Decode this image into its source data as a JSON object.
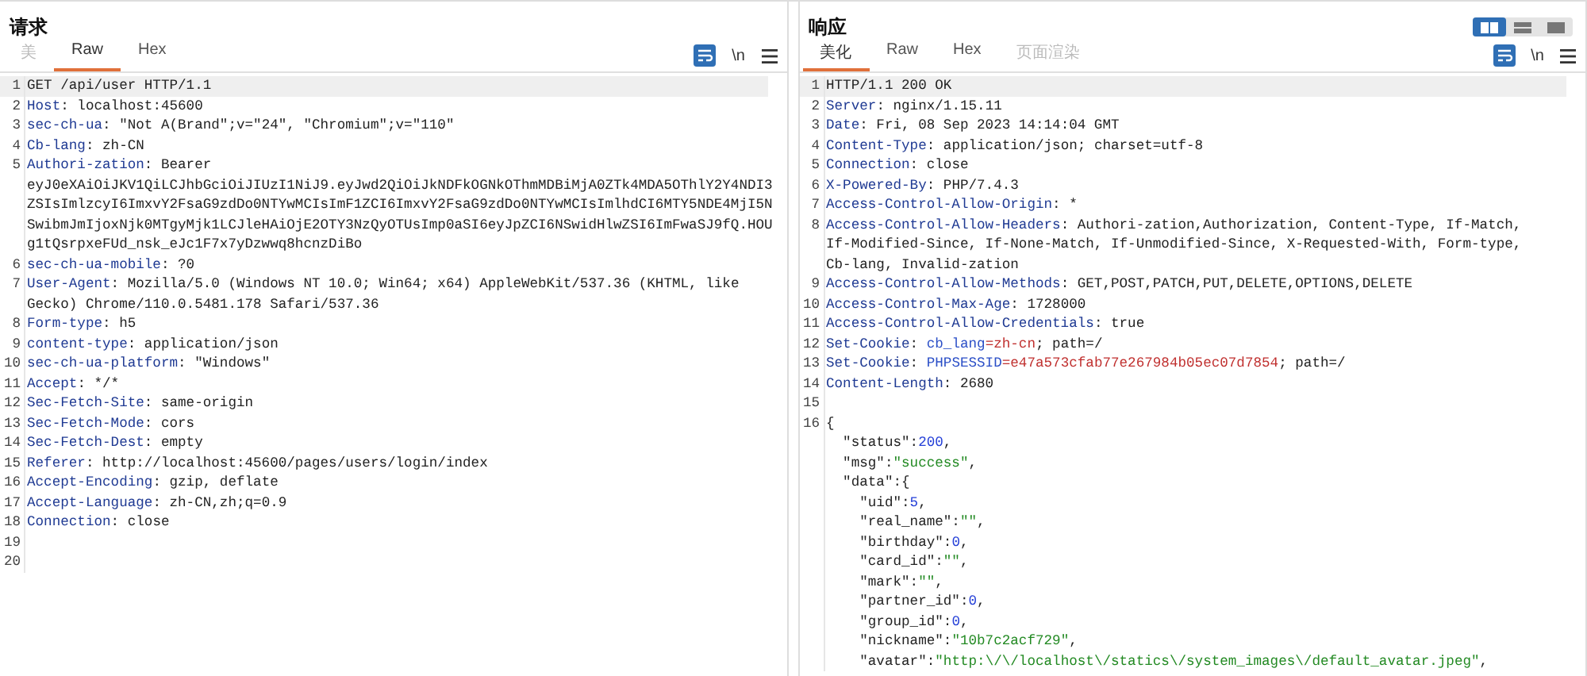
{
  "layout_buttons": [
    {
      "selected": true
    },
    {
      "selected": false
    },
    {
      "selected": false
    }
  ],
  "panels": [
    {
      "title": "请求",
      "tabs": [
        {
          "label": "美",
          "selected": false,
          "disabled": true
        },
        {
          "label": "Raw",
          "selected": true,
          "disabled": false
        },
        {
          "label": "Hex",
          "selected": false,
          "disabled": false
        }
      ],
      "wrap_on": true,
      "newline_toggle": "\\n",
      "lines": [
        {
          "n": "1",
          "highlight": true,
          "rows": [
            [
              {
                "kind": "plain",
                "text": "GET /api/user HTTP/1.1"
              }
            ]
          ]
        },
        {
          "n": "2",
          "highlight": false,
          "rows": [
            [
              {
                "kind": "key",
                "text": "Host"
              },
              {
                "kind": "plain",
                "text": ": localhost:45600"
              }
            ]
          ]
        },
        {
          "n": "3",
          "highlight": false,
          "rows": [
            [
              {
                "kind": "key",
                "text": "sec-ch-ua"
              },
              {
                "kind": "plain",
                "text": ": \"Not A(Brand\";v=\"24\", \"Chromium\";v=\"110\""
              }
            ]
          ]
        },
        {
          "n": "4",
          "highlight": false,
          "rows": [
            [
              {
                "kind": "key",
                "text": "Cb-lang"
              },
              {
                "kind": "plain",
                "text": ": zh-CN"
              }
            ]
          ]
        },
        {
          "n": "5",
          "highlight": false,
          "rows": [
            [
              {
                "kind": "key",
                "text": "Authori-zation"
              },
              {
                "kind": "plain",
                "text": ": Bearer"
              }
            ],
            [
              {
                "kind": "plain",
                "text": "eyJ0eXAiOiJKV1QiLCJhbGciOiJIUzI1NiJ9.eyJwd2QiOiJkNDFkOGNkOThmMDBiMjA0ZTk4MDA5OThlY2Y4NDI3"
              }
            ],
            [
              {
                "kind": "plain",
                "text": "ZSIsImlzcyI6ImxvY2FsaG9zdDo0NTYwMCIsImF1ZCI6ImxvY2FsaG9zdDo0NTYwMCIsImlhdCI6MTY5NDE4MjI5N"
              }
            ],
            [
              {
                "kind": "plain",
                "text": "SwibmJmIjoxNjk0MTgyMjk1LCJleHAiOjE2OTY3NzQyOTUsImp0aSI6eyJpZCI6NSwidHlwZSI6ImFwaSJ9fQ.HOU"
              }
            ],
            [
              {
                "kind": "plain",
                "text": "g1tQsrpxeFUd_nsk_eJc1F7x7yDzwwq8hcnzDiBo"
              }
            ]
          ]
        },
        {
          "n": "6",
          "highlight": false,
          "rows": [
            [
              {
                "kind": "key",
                "text": "sec-ch-ua-mobile"
              },
              {
                "kind": "plain",
                "text": ": ?0"
              }
            ]
          ]
        },
        {
          "n": "7",
          "highlight": false,
          "rows": [
            [
              {
                "kind": "key",
                "text": "User-Agent"
              },
              {
                "kind": "plain",
                "text": ": Mozilla/5.0 (Windows NT 10.0; Win64; x64) AppleWebKit/537.36 (KHTML, like"
              }
            ],
            [
              {
                "kind": "plain",
                "text": "Gecko) Chrome/110.0.5481.178 Safari/537.36"
              }
            ]
          ]
        },
        {
          "n": "8",
          "highlight": false,
          "rows": [
            [
              {
                "kind": "key",
                "text": "Form-type"
              },
              {
                "kind": "plain",
                "text": ": h5"
              }
            ]
          ]
        },
        {
          "n": "9",
          "highlight": false,
          "rows": [
            [
              {
                "kind": "key",
                "text": "content-type"
              },
              {
                "kind": "plain",
                "text": ": application/json"
              }
            ]
          ]
        },
        {
          "n": "10",
          "highlight": false,
          "rows": [
            [
              {
                "kind": "key",
                "text": "sec-ch-ua-platform"
              },
              {
                "kind": "plain",
                "text": ": \"Windows\""
              }
            ]
          ]
        },
        {
          "n": "11",
          "highlight": false,
          "rows": [
            [
              {
                "kind": "key",
                "text": "Accept"
              },
              {
                "kind": "plain",
                "text": ": */*"
              }
            ]
          ]
        },
        {
          "n": "12",
          "highlight": false,
          "rows": [
            [
              {
                "kind": "key",
                "text": "Sec-Fetch-Site"
              },
              {
                "kind": "plain",
                "text": ": same-origin"
              }
            ]
          ]
        },
        {
          "n": "13",
          "highlight": false,
          "rows": [
            [
              {
                "kind": "key",
                "text": "Sec-Fetch-Mode"
              },
              {
                "kind": "plain",
                "text": ": cors"
              }
            ]
          ]
        },
        {
          "n": "14",
          "highlight": false,
          "rows": [
            [
              {
                "kind": "key",
                "text": "Sec-Fetch-Dest"
              },
              {
                "kind": "plain",
                "text": ": empty"
              }
            ]
          ]
        },
        {
          "n": "15",
          "highlight": false,
          "rows": [
            [
              {
                "kind": "key",
                "text": "Referer"
              },
              {
                "kind": "plain",
                "text": ": http://localhost:45600/pages/users/login/index"
              }
            ]
          ]
        },
        {
          "n": "16",
          "highlight": false,
          "rows": [
            [
              {
                "kind": "key",
                "text": "Accept-Encoding"
              },
              {
                "kind": "plain",
                "text": ": gzip, deflate"
              }
            ]
          ]
        },
        {
          "n": "17",
          "highlight": false,
          "rows": [
            [
              {
                "kind": "key",
                "text": "Accept-Language"
              },
              {
                "kind": "plain",
                "text": ": zh-CN,zh;q=0.9"
              }
            ]
          ]
        },
        {
          "n": "18",
          "highlight": false,
          "rows": [
            [
              {
                "kind": "key",
                "text": "Connection"
              },
              {
                "kind": "plain",
                "text": ": close"
              }
            ]
          ]
        },
        {
          "n": "19",
          "highlight": false,
          "rows": [
            []
          ]
        },
        {
          "n": "20",
          "highlight": false,
          "rows": [
            []
          ]
        }
      ]
    },
    {
      "title": "响应",
      "tabs": [
        {
          "label": "美化",
          "selected": true,
          "disabled": false
        },
        {
          "label": "Raw",
          "selected": false,
          "disabled": false
        },
        {
          "label": "Hex",
          "selected": false,
          "disabled": false
        },
        {
          "label": "页面渲染",
          "selected": false,
          "disabled": true
        }
      ],
      "wrap_on": true,
      "newline_toggle": "\\n",
      "lines": [
        {
          "n": "1",
          "highlight": true,
          "rows": [
            [
              {
                "kind": "plain",
                "text": "HTTP/1.1 200 OK"
              }
            ]
          ]
        },
        {
          "n": "2",
          "highlight": false,
          "rows": [
            [
              {
                "kind": "key",
                "text": "Server"
              },
              {
                "kind": "plain",
                "text": ": nginx/1.15.11"
              }
            ]
          ]
        },
        {
          "n": "3",
          "highlight": false,
          "rows": [
            [
              {
                "kind": "key",
                "text": "Date"
              },
              {
                "kind": "plain",
                "text": ": Fri, 08 Sep 2023 14:14:04 GMT"
              }
            ]
          ]
        },
        {
          "n": "4",
          "highlight": false,
          "rows": [
            [
              {
                "kind": "key",
                "text": "Content-Type"
              },
              {
                "kind": "plain",
                "text": ": application/json; charset=utf-8"
              }
            ]
          ]
        },
        {
          "n": "5",
          "highlight": false,
          "rows": [
            [
              {
                "kind": "key",
                "text": "Connection"
              },
              {
                "kind": "plain",
                "text": ": close"
              }
            ]
          ]
        },
        {
          "n": "6",
          "highlight": false,
          "rows": [
            [
              {
                "kind": "key",
                "text": "X-Powered-By"
              },
              {
                "kind": "plain",
                "text": ": PHP/7.4.3"
              }
            ]
          ]
        },
        {
          "n": "7",
          "highlight": false,
          "rows": [
            [
              {
                "kind": "key",
                "text": "Access-Control-Allow-Origin"
              },
              {
                "kind": "plain",
                "text": ": *"
              }
            ]
          ]
        },
        {
          "n": "8",
          "highlight": false,
          "rows": [
            [
              {
                "kind": "key",
                "text": "Access-Control-Allow-Headers"
              },
              {
                "kind": "plain",
                "text": ": Authori-zation,Authorization, Content-Type, If-Match,"
              }
            ],
            [
              {
                "kind": "plain",
                "text": "If-Modified-Since, If-None-Match, If-Unmodified-Since, X-Requested-With, Form-type,"
              }
            ],
            [
              {
                "kind": "plain",
                "text": "Cb-lang, Invalid-zation"
              }
            ]
          ]
        },
        {
          "n": "9",
          "highlight": false,
          "rows": [
            [
              {
                "kind": "key",
                "text": "Access-Control-Allow-Methods"
              },
              {
                "kind": "plain",
                "text": ": GET,POST,PATCH,PUT,DELETE,OPTIONS,DELETE"
              }
            ]
          ]
        },
        {
          "n": "10",
          "highlight": false,
          "rows": [
            [
              {
                "kind": "key",
                "text": "Access-Control-Max-Age"
              },
              {
                "kind": "plain",
                "text": ": 1728000"
              }
            ]
          ]
        },
        {
          "n": "11",
          "highlight": false,
          "rows": [
            [
              {
                "kind": "key",
                "text": "Access-Control-Allow-Credentials"
              },
              {
                "kind": "plain",
                "text": ": true"
              }
            ]
          ]
        },
        {
          "n": "12",
          "highlight": false,
          "rows": [
            [
              {
                "kind": "key",
                "text": "Set-Cookie"
              },
              {
                "kind": "plain",
                "text": ": "
              },
              {
                "kind": "cookie_name",
                "text": "cb_lang"
              },
              {
                "kind": "cookie_value",
                "text": "=zh-cn"
              },
              {
                "kind": "plain",
                "text": "; path=/"
              }
            ]
          ]
        },
        {
          "n": "13",
          "highlight": false,
          "rows": [
            [
              {
                "kind": "key",
                "text": "Set-Cookie"
              },
              {
                "kind": "plain",
                "text": ": "
              },
              {
                "kind": "cookie_name",
                "text": "PHPSESSID"
              },
              {
                "kind": "cookie_value",
                "text": "=e47a573cfab77e267984b05ec07d7854"
              },
              {
                "kind": "plain",
                "text": "; path=/"
              }
            ]
          ]
        },
        {
          "n": "14",
          "highlight": false,
          "rows": [
            [
              {
                "kind": "key",
                "text": "Content-Length"
              },
              {
                "kind": "plain",
                "text": ": 2680"
              }
            ]
          ]
        },
        {
          "n": "15",
          "highlight": false,
          "rows": [
            []
          ]
        },
        {
          "n": "16",
          "highlight": false,
          "rows": [
            [
              {
                "kind": "plain",
                "text": "{"
              }
            ],
            [
              {
                "kind": "plain",
                "text": "  \"status\":"
              },
              {
                "kind": "number",
                "text": "200"
              },
              {
                "kind": "plain",
                "text": ","
              }
            ],
            [
              {
                "kind": "plain",
                "text": "  \"msg\":"
              },
              {
                "kind": "string",
                "text": "\"success\""
              },
              {
                "kind": "plain",
                "text": ","
              }
            ],
            [
              {
                "kind": "plain",
                "text": "  \"data\":{"
              }
            ],
            [
              {
                "kind": "plain",
                "text": "    \"uid\":"
              },
              {
                "kind": "number",
                "text": "5"
              },
              {
                "kind": "plain",
                "text": ","
              }
            ],
            [
              {
                "kind": "plain",
                "text": "    \"real_name\":"
              },
              {
                "kind": "string",
                "text": "\"\""
              },
              {
                "kind": "plain",
                "text": ","
              }
            ],
            [
              {
                "kind": "plain",
                "text": "    \"birthday\":"
              },
              {
                "kind": "number",
                "text": "0"
              },
              {
                "kind": "plain",
                "text": ","
              }
            ],
            [
              {
                "kind": "plain",
                "text": "    \"card_id\":"
              },
              {
                "kind": "string",
                "text": "\"\""
              },
              {
                "kind": "plain",
                "text": ","
              }
            ],
            [
              {
                "kind": "plain",
                "text": "    \"mark\":"
              },
              {
                "kind": "string",
                "text": "\"\""
              },
              {
                "kind": "plain",
                "text": ","
              }
            ],
            [
              {
                "kind": "plain",
                "text": "    \"partner_id\":"
              },
              {
                "kind": "number",
                "text": "0"
              },
              {
                "kind": "plain",
                "text": ","
              }
            ],
            [
              {
                "kind": "plain",
                "text": "    \"group_id\":"
              },
              {
                "kind": "number",
                "text": "0"
              },
              {
                "kind": "plain",
                "text": ","
              }
            ],
            [
              {
                "kind": "plain",
                "text": "    \"nickname\":"
              },
              {
                "kind": "string",
                "text": "\"10b7c2acf729\""
              },
              {
                "kind": "plain",
                "text": ","
              }
            ],
            [
              {
                "kind": "plain",
                "text": "    \"avatar\":"
              },
              {
                "kind": "string",
                "text": "\"http:\\/\\/localhost\\/statics\\/system_images\\/default_avatar.jpeg\""
              },
              {
                "kind": "plain",
                "text": ","
              }
            ]
          ]
        }
      ]
    }
  ]
}
